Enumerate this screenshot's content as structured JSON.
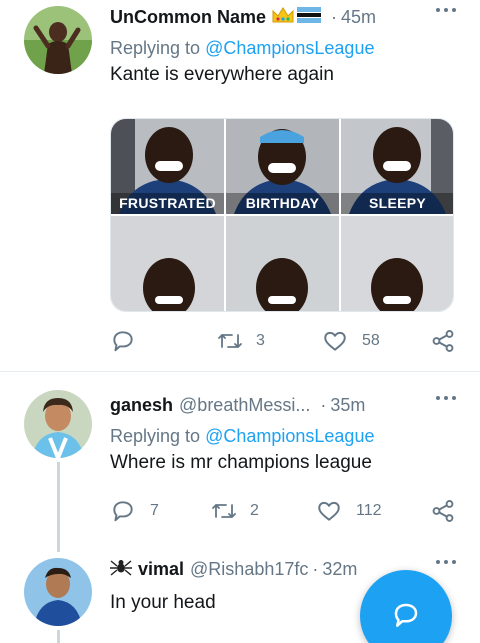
{
  "tweet1": {
    "name": "UnCommon Name",
    "badges": [
      "crown-emoji",
      "flag-emoji"
    ],
    "time": "45m",
    "replying_label": "Replying to",
    "replying_to": "@ChampionsLeague",
    "text": "Kante is everywhere again",
    "captions": [
      "FRUSTRATED",
      "BIRTHDAY",
      "SLEEPY"
    ],
    "retweets": "3",
    "likes": "58"
  },
  "tweet2": {
    "name": "ganesh",
    "handle": "@breathMessi...",
    "time": "35m",
    "replying_label": "Replying to",
    "replying_to": "@ChampionsLeague",
    "text": "Where is mr champions league",
    "replies": "7",
    "retweets": "2",
    "likes": "112"
  },
  "tweet3": {
    "name": "vimal",
    "name_prefix_icon": "spider-emoji",
    "handle": "@Rishabh17fc",
    "time": "32m",
    "text": "In your head"
  },
  "separator": "·",
  "icons": [
    "more-icon",
    "reply-icon",
    "retweet-icon",
    "like-icon",
    "share-icon",
    "compose-reply-icon"
  ],
  "colors": {
    "accent": "#1da1f2",
    "secondary_text": "#657786",
    "divider": "#e6ecf0"
  }
}
